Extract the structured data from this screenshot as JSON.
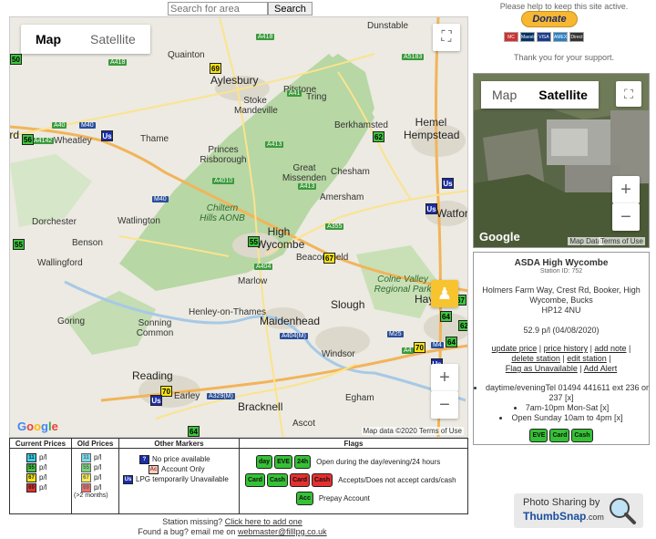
{
  "search": {
    "placeholder": "Search for area",
    "button": "Search"
  },
  "map": {
    "toggle_map": "Map",
    "toggle_satellite": "Satellite",
    "google": "Google",
    "credit": "Map data ©2020   Terms of Use",
    "places": [
      {
        "t": "Dunstable",
        "c": "place"
      },
      {
        "t": "Quainton",
        "c": "place"
      },
      {
        "t": "Aylesbury",
        "c": "place big"
      },
      {
        "t": "Pitstone",
        "c": "place"
      },
      {
        "t": "Stoke Mandeville",
        "c": "place"
      },
      {
        "t": "Tring",
        "c": "place"
      },
      {
        "t": "Wheatley",
        "c": "place"
      },
      {
        "t": "Thame",
        "c": "place"
      },
      {
        "t": "Berkhamsted",
        "c": "place"
      },
      {
        "t": "Hemel Hempstead",
        "c": "place big"
      },
      {
        "t": "Princes Risborough",
        "c": "place"
      },
      {
        "t": "Great Missenden",
        "c": "place"
      },
      {
        "t": "Chesham",
        "c": "place"
      },
      {
        "t": "Amersham",
        "c": "place"
      },
      {
        "t": "Chiltern Hills AONB",
        "c": "place green"
      },
      {
        "t": "High Wycombe",
        "c": "place big"
      },
      {
        "t": "Watlington",
        "c": "place"
      },
      {
        "t": "Dorchester",
        "c": "place"
      },
      {
        "t": "Benson",
        "c": "place"
      },
      {
        "t": "Wallingford",
        "c": "place"
      },
      {
        "t": "Beaconsfield",
        "c": "place"
      },
      {
        "t": "Watford",
        "c": "place big"
      },
      {
        "t": "Marlow",
        "c": "place"
      },
      {
        "t": "Colne Valley Regional Park",
        "c": "place green"
      },
      {
        "t": "Henley-on-Thames",
        "c": "place"
      },
      {
        "t": "Goring",
        "c": "place"
      },
      {
        "t": "Sonning Common",
        "c": "place"
      },
      {
        "t": "Maidenhead",
        "c": "place big"
      },
      {
        "t": "Slough",
        "c": "place big"
      },
      {
        "t": "Haye",
        "c": "place big"
      },
      {
        "t": "Windsor",
        "c": "place"
      },
      {
        "t": "Reading",
        "c": "place big"
      },
      {
        "t": "Earley",
        "c": "place"
      },
      {
        "t": "Bracknell",
        "c": "place big"
      },
      {
        "t": "Egham",
        "c": "place"
      },
      {
        "t": "Ascot",
        "c": "place"
      },
      {
        "t": "Oxford",
        "c": "place big"
      }
    ],
    "roads": [
      "A418",
      "A41",
      "A5183",
      "A40",
      "M40",
      "A4142",
      "A418",
      "A413",
      "A4010",
      "A413",
      "M40",
      "A355",
      "A404",
      "A404(M)",
      "M25",
      "M4",
      "A329(M)",
      "A4"
    ],
    "markers": [
      "69",
      "56",
      "50",
      "62",
      "Us",
      "Us",
      "Us",
      "55",
      "67",
      "55",
      "64",
      "62",
      "70",
      "Us",
      "70",
      "64",
      "Us",
      "67",
      "64"
    ]
  },
  "donate": {
    "help_text": "Please help to keep this site active.",
    "button": "Donate",
    "thanks": "Thank you for your support.",
    "cards": [
      "MC",
      "Maestro",
      "VISA",
      "AMEX",
      "Direct"
    ]
  },
  "mini_map": {
    "toggle_map": "Map",
    "toggle_satellite": "Satellite",
    "google": "Google",
    "credit_data": "Map Data",
    "credit_terms": "Terms of Use"
  },
  "station": {
    "name": "ASDA High Wycombe",
    "station_id": "Station ID: 752",
    "address": "Holmers Farm Way, Crest Rd, Booker, High Wycombe, Bucks",
    "postcode": "HP12 4NU",
    "price": "52.9 p/l (04/08/2020)",
    "links": [
      "update price",
      "price history",
      "add note",
      "delete station",
      "edit station",
      "Flag as Unavailable",
      "Add Alert"
    ],
    "hours": [
      "daytime/eveningTel 01494 441611 ext 236 or 237 [x]",
      "7am-10pm Mon-Sat [x]",
      "Open Sunday 10am to 4pm [x]"
    ],
    "flags": [
      "EVE",
      "Card",
      "Cash"
    ]
  },
  "legend": {
    "current_prices": "Current Prices",
    "old_prices": "Old Prices",
    "old_note": "(>2 months)",
    "unit": "p/l",
    "other_markers": "Other Markers",
    "no_price": "No price available",
    "account_only": "Account Only",
    "lpg_unavail": "LPG temporarily Unavailable",
    "flags_title": "Flags",
    "flag_open": "Open during the day/evening/24 hours",
    "flag_accepts": "Accepts/Does not accept cards/cash",
    "flag_prepay": "Prepay Account",
    "flag_day": "day",
    "flag_eve": "EVE",
    "flag_24h": "24h",
    "flag_card": "Card",
    "flag_cash": "Cash",
    "flag_acc": "Acc",
    "marker_nums": [
      "11",
      "55",
      "67",
      "69"
    ],
    "marker_q": "?",
    "marker_ac": "Ac",
    "marker_us": "Us"
  },
  "footer": {
    "missing": "Station missing?",
    "missing_link": "Click here to add one",
    "bug": "Found a bug? email me on",
    "email": "webmaster@filllpg.co.uk"
  },
  "thumbsnap": {
    "line1": "Photo Sharing by",
    "brand": "ThumbSnap",
    "tld": ".com"
  }
}
